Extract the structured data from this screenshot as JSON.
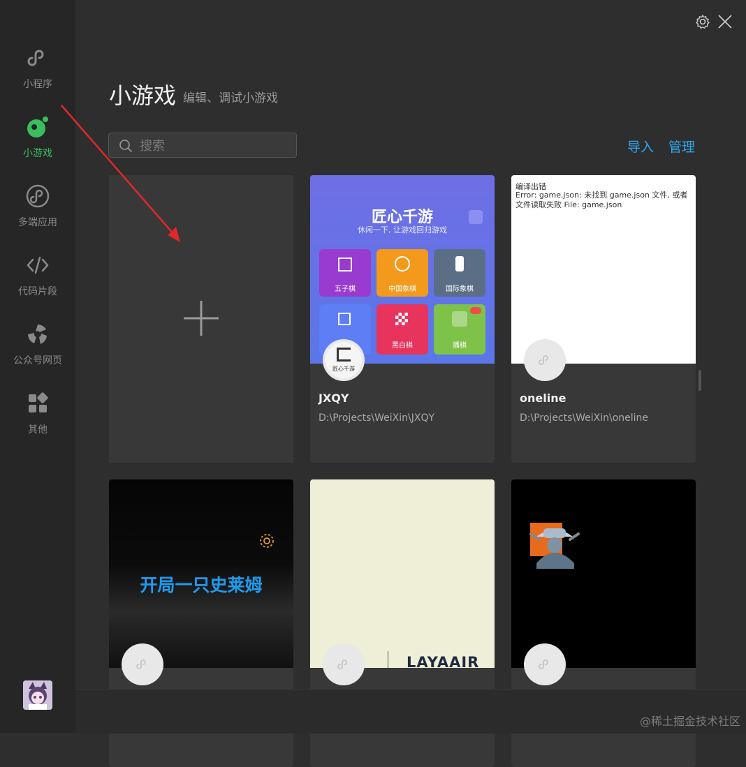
{
  "sidebar": {
    "items": [
      {
        "label": "小程序",
        "icon": "link-icon"
      },
      {
        "label": "小游戏",
        "icon": "game-icon"
      },
      {
        "label": "多端应用",
        "icon": "multi-link-icon"
      },
      {
        "label": "代码片段",
        "icon": "code-icon"
      },
      {
        "label": "公众号网页",
        "icon": "official-account-icon"
      },
      {
        "label": "其他",
        "icon": "grid-icon"
      }
    ],
    "active_color": "#3bbf5e"
  },
  "header": {
    "title": "小游戏",
    "subtitle": "编辑、调试小游戏"
  },
  "search": {
    "placeholder": "搜索"
  },
  "actions": {
    "import_label": "导入",
    "manage_label": "管理"
  },
  "cards": [
    {
      "name": "JXQY",
      "path": "D:\\Projects\\WeiXin\\JXQY",
      "preview": {
        "title": "匠心千游",
        "tagline": "休闲一下, 让游戏回归游戏",
        "games": [
          "五子棋",
          "中国象棋",
          "国际象棋",
          "",
          "黑白棋",
          "播棋"
        ],
        "badge_label": "匠心千游"
      }
    },
    {
      "name": "oneline",
      "path": "D:\\Projects\\WeiXin\\oneline",
      "preview": {
        "error_title": "编译出错",
        "error_text": "Error: game.json: 未找到 game.json 文件, 或者文件读取失败 File: game.json"
      }
    },
    {
      "preview": {
        "title": "开局一只史莱姆"
      }
    },
    {
      "preview": {
        "logo": "LAYAAIR"
      }
    },
    {
      "preview": {}
    }
  ],
  "watermark": "@稀土掘金技术社区"
}
